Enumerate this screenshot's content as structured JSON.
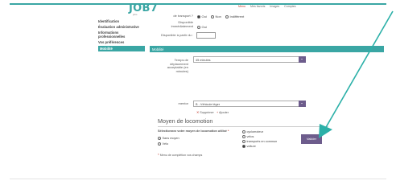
{
  "logo": {
    "text": "JOB7",
    "sub": "jobs"
  },
  "topnav": [
    "Menu",
    "Mes favoris",
    "Images",
    "Comptes"
  ],
  "sidebar": {
    "items": [
      "Identification",
      "Évaluation administrative",
      "Informations professionnelles",
      "Vos préférences",
      "Mobilité"
    ]
  },
  "form": {
    "transport_label": "de transport ?",
    "transport_options": [
      "Oui",
      "Non",
      "Indifférent"
    ],
    "dispo_label": "Disponible immédiatement",
    "dispo_option": "Oui",
    "dispo_from_label": "Disponible à partir du :",
    "section_title": "Mobilité",
    "temps_label": "Temps de déplacement acceptable (en minutes)",
    "temps_value": "45 minutes",
    "mentor_label": "mentor",
    "mentor_value": "B - Véhicule léger",
    "supprimer": "Supprimer",
    "ajouter": "Ajouter"
  },
  "meyen": {
    "title": "Moyen de locomotion",
    "label": "Sélectionnez votre moyen de locomotion utilisé",
    "left_options": [
      "Sans moyen",
      "Vélo"
    ],
    "right_options": [
      "cyclomoteur",
      "vélos",
      "transports en commun",
      "voiture"
    ],
    "selected": "voiture"
  },
  "valider_label": "Valider",
  "required_note": "Menu de complétion vos champs",
  "colors": {
    "accent": "#3aa6a4",
    "button": "#6d5c8c",
    "arrow": "#2bb0a8",
    "required": "#c0392b"
  }
}
